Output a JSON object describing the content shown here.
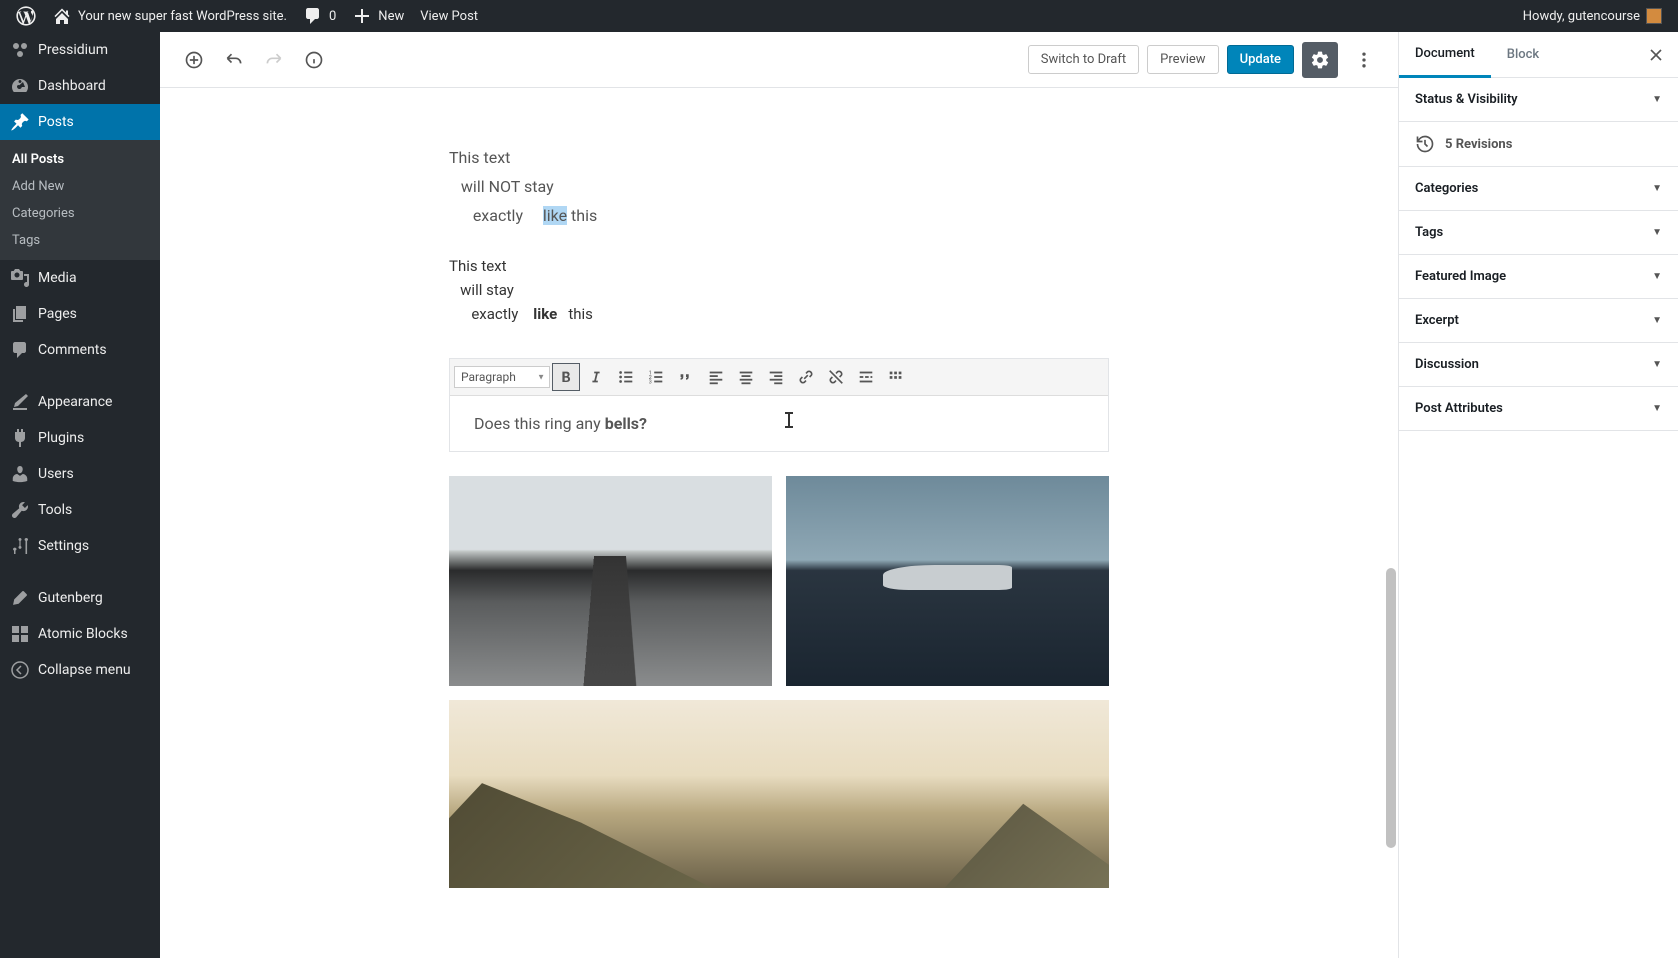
{
  "adminBar": {
    "siteName": "Your new super fast WordPress site.",
    "comments": "0",
    "new": "New",
    "viewPost": "View Post",
    "howdy": "Howdy, gutencourse"
  },
  "sidebar": {
    "brand": "Pressidium",
    "items": [
      {
        "label": "Dashboard",
        "icon": "dashboard"
      },
      {
        "label": "Posts",
        "icon": "pin",
        "current": true,
        "sub": [
          {
            "label": "All Posts",
            "current": true
          },
          {
            "label": "Add New"
          },
          {
            "label": "Categories"
          },
          {
            "label": "Tags"
          }
        ]
      },
      {
        "label": "Media",
        "icon": "media"
      },
      {
        "label": "Pages",
        "icon": "pages"
      },
      {
        "label": "Comments",
        "icon": "comments"
      },
      {
        "label": "Appearance",
        "icon": "brush"
      },
      {
        "label": "Plugins",
        "icon": "plug"
      },
      {
        "label": "Users",
        "icon": "user"
      },
      {
        "label": "Tools",
        "icon": "wrench"
      },
      {
        "label": "Settings",
        "icon": "sliders"
      },
      {
        "label": "Gutenberg",
        "icon": "pencil"
      },
      {
        "label": "Atomic Blocks",
        "icon": "blocks"
      },
      {
        "label": "Collapse menu",
        "icon": "collapse"
      }
    ]
  },
  "header": {
    "switchDraft": "Switch to Draft",
    "preview": "Preview",
    "update": "Update"
  },
  "content": {
    "verse": {
      "l1": "This text",
      "l2": "   will NOT stay",
      "l3_a": "      exactly     ",
      "l3_hl": "like",
      "l3_b": " this"
    },
    "pre": "This text\n   will stay\n      exactly    like   this",
    "classicFormat": "Paragraph",
    "classicTextA": "Does this ring any ",
    "classicTextB": "bells?"
  },
  "settings": {
    "tabs": {
      "document": "Document",
      "block": "Block"
    },
    "panels": {
      "status": "Status & Visibility",
      "revisions": "5 Revisions",
      "categories": "Categories",
      "tags": "Tags",
      "featured": "Featured Image",
      "excerpt": "Excerpt",
      "discussion": "Discussion",
      "attributes": "Post Attributes"
    }
  }
}
